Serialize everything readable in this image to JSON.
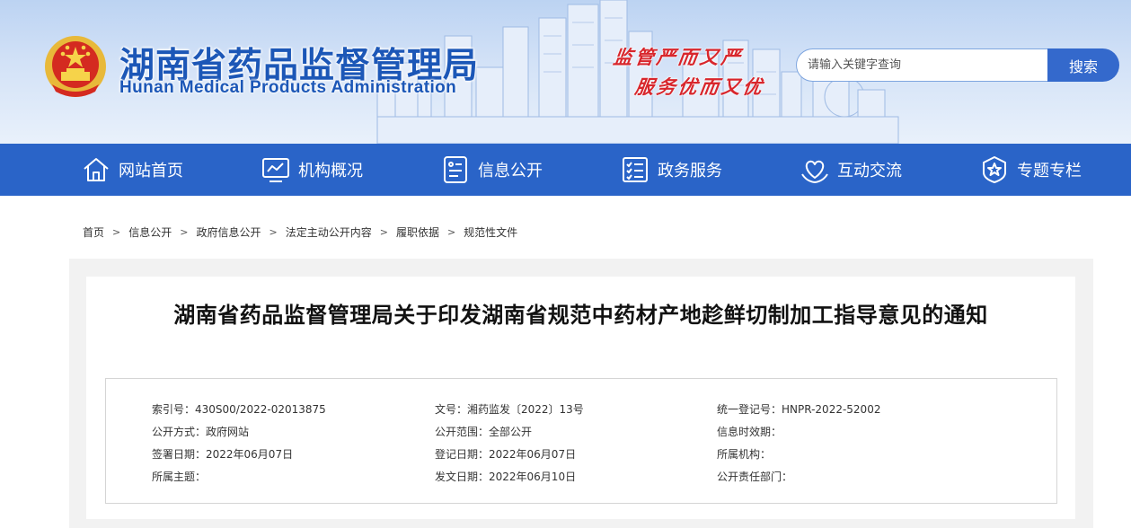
{
  "header": {
    "title": "湖南省药品监督管理局",
    "subtitle": "Hunan Medical Products Administration",
    "slogan_line1": "监管严而又严",
    "slogan_line2": "服务优而又优",
    "search_placeholder": "请输入关键字查询",
    "search_button": "搜索"
  },
  "nav": {
    "items": [
      {
        "label": "网站首页",
        "icon": "home-icon"
      },
      {
        "label": "机构概况",
        "icon": "chart-monitor-icon"
      },
      {
        "label": "信息公开",
        "icon": "info-card-icon"
      },
      {
        "label": "政务服务",
        "icon": "checklist-icon"
      },
      {
        "label": "互动交流",
        "icon": "heart-hands-icon"
      },
      {
        "label": "专题专栏",
        "icon": "star-badge-icon"
      }
    ]
  },
  "breadcrumb": [
    "首页",
    "信息公开",
    "政府信息公开",
    "法定主动公开内容",
    "履职依据",
    "规范性文件"
  ],
  "breadcrumb_separator": ">",
  "document": {
    "title": "湖南省药品监督管理局关于印发湖南省规范中药材产地趁鲜切制加工指导意见的通知",
    "meta": {
      "index_no": "索引号：430S00/2022-02013875",
      "doc_no": "文号：湘药监发〔2022〕13号",
      "unified_reg_no": "统一登记号：HNPR-2022-52002",
      "publish_method": "公开方式：政府网站",
      "publish_scope": "公开范围：全部公开",
      "validity": "信息时效期：",
      "sign_date": "签署日期：2022年06月07日",
      "reg_date": "登记日期：2022年06月07日",
      "agency": "所属机构：",
      "topic": "所属主题：",
      "issue_date": "发文日期：2022年06月10日",
      "responsible_dept": "公开责任部门："
    }
  },
  "colors": {
    "brand_blue": "#2a64c8",
    "title_blue": "#1c57b7",
    "slogan_red": "#d8262c",
    "search_button": "#3469cc"
  }
}
